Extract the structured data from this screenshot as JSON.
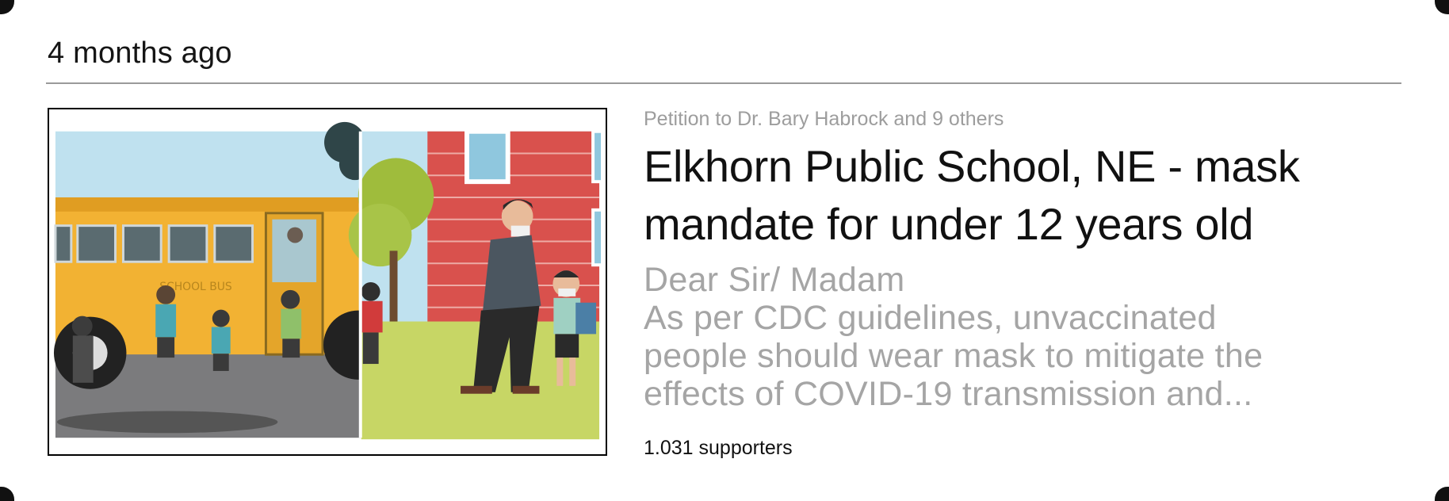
{
  "post": {
    "timestamp": "4 months ago",
    "petition_to": "Petition to Dr. Bary Habrock and 9 others",
    "title": "Elkhorn Public School, NE - mask mandate for under 12 years old",
    "excerpt_lines": [
      "Dear Sir/ Madam",
      "As per CDC guidelines, unvaccinated",
      "people should wear mask to mitigate the",
      "effects of COVID-19 transmission and..."
    ],
    "supporters": "1.031 supporters",
    "image": {
      "description_icon": "school-mask-illustration",
      "bus_label": "SCHOOL BUS"
    }
  },
  "colors": {
    "text": "#111111",
    "muted": "#a5a5a5",
    "divider": "#9a9a9a",
    "bus_yellow": "#f2b233",
    "brick_red": "#d9514d"
  }
}
